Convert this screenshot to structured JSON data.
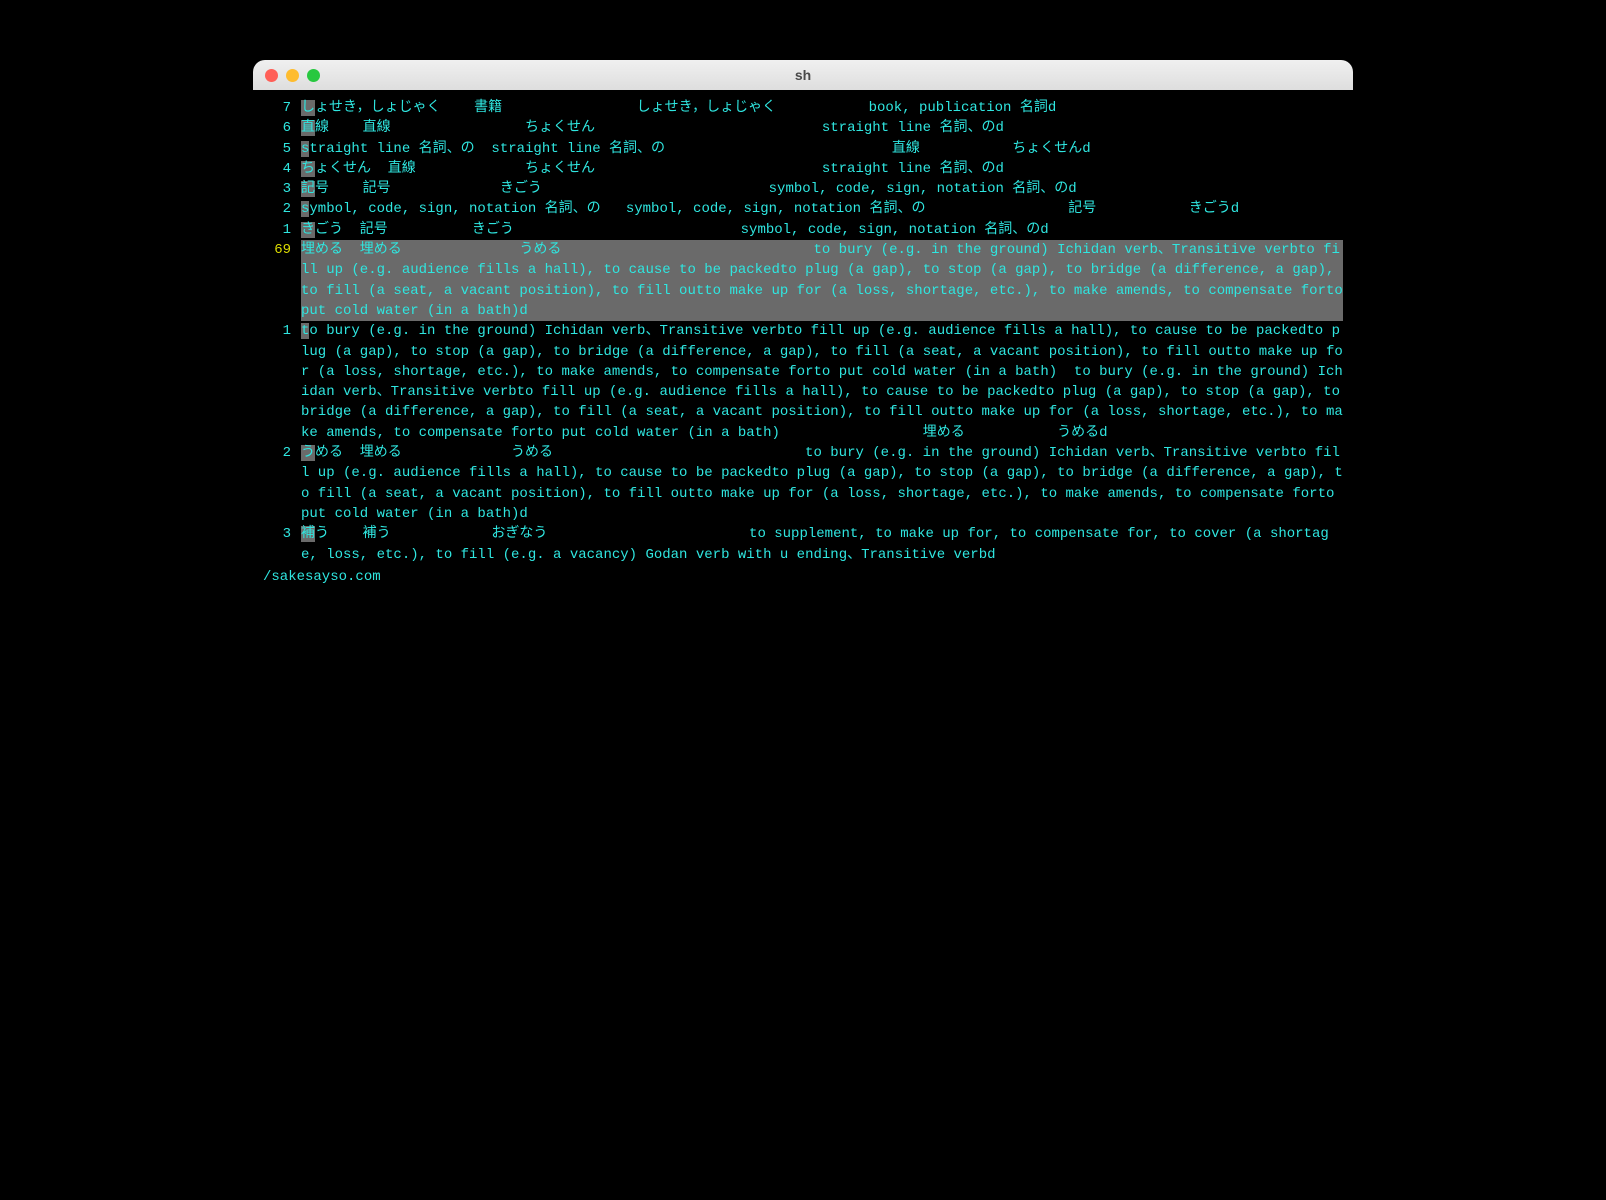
{
  "window": {
    "title": "sh"
  },
  "rows": [
    {
      "num": "7",
      "first": "し",
      "rest": "ょせき，しょじゃく    書籍                しょせき，しょじゃく           book, publication 名詞d"
    },
    {
      "num": "6",
      "first": "直",
      "rest": "線    直線                ちょくせん                           straight line 名詞、のd"
    },
    {
      "num": "5",
      "first": "s",
      "rest": "traight line 名詞、の  straight line 名詞、の                           直線           ちょくせんd"
    },
    {
      "num": "4",
      "first": "ち",
      "rest": "ょくせん  直線             ちょくせん                           straight line 名詞、のd"
    },
    {
      "num": "3",
      "first": "記",
      "rest": "号    記号             きごう                           symbol, code, sign, notation 名詞、のd"
    },
    {
      "num": "2",
      "first": "s",
      "rest": "ymbol, code, sign, notation 名詞、の   symbol, code, sign, notation 名詞、の                 記号           きごうd"
    },
    {
      "num": "1",
      "first": "き",
      "rest": "ごう  記号          きごう                           symbol, code, sign, notation 名詞、のd"
    },
    {
      "num": "69",
      "selected": true,
      "first": "",
      "rest": "埋める  埋める              うめる                              to bury (e.g. in the ground) Ichidan verb、Transitive verbto fill up (e.g. audience fills a hall), to cause to be packedto plug (a gap), to stop (a gap), to bridge (a difference, a gap), to fill (a seat, a vacant position), to fill outto make up for (a loss, shortage, etc.), to make amends, to compensate forto put cold water (in a bath)d"
    },
    {
      "num": "1",
      "first": "t",
      "rest": "o bury (e.g. in the ground) Ichidan verb、Transitive verbto fill up (e.g. audience fills a hall), to cause to be packedto plug (a gap), to stop (a gap), to bridge (a difference, a gap), to fill (a seat, a vacant position), to fill outto make up for (a loss, shortage, etc.), to make amends, to compensate forto put cold water (in a bath)  to bury (e.g. in the ground) Ichidan verb、Transitive verbto fill up (e.g. audience fills a hall), to cause to be packedto plug (a gap), to stop (a gap), to bridge (a difference, a gap), to fill (a seat, a vacant position), to fill outto make up for (a loss, shortage, etc.), to make amends, to compensate forto put cold water (in a bath)                 埋める           うめるd"
    },
    {
      "num": "2",
      "first": "う",
      "rest": "める  埋める             うめる                              to bury (e.g. in the ground) Ichidan verb、Transitive verbto fill up (e.g. audience fills a hall), to cause to be packedto plug (a gap), to stop (a gap), to bridge (a difference, a gap), to fill (a seat, a vacant position), to fill outto make up for (a loss, shortage, etc.), to make amends, to compensate forto put cold water (in a bath)d"
    },
    {
      "num": "3",
      "first": "補",
      "rest": "う    補う            おぎなう                        to supplement, to make up for, to compensate for, to cover (a shortage, loss, etc.), to fill (e.g. a vacancy) Godan verb with u ending、Transitive verbd"
    }
  ],
  "footer": "/sakesayso.com"
}
